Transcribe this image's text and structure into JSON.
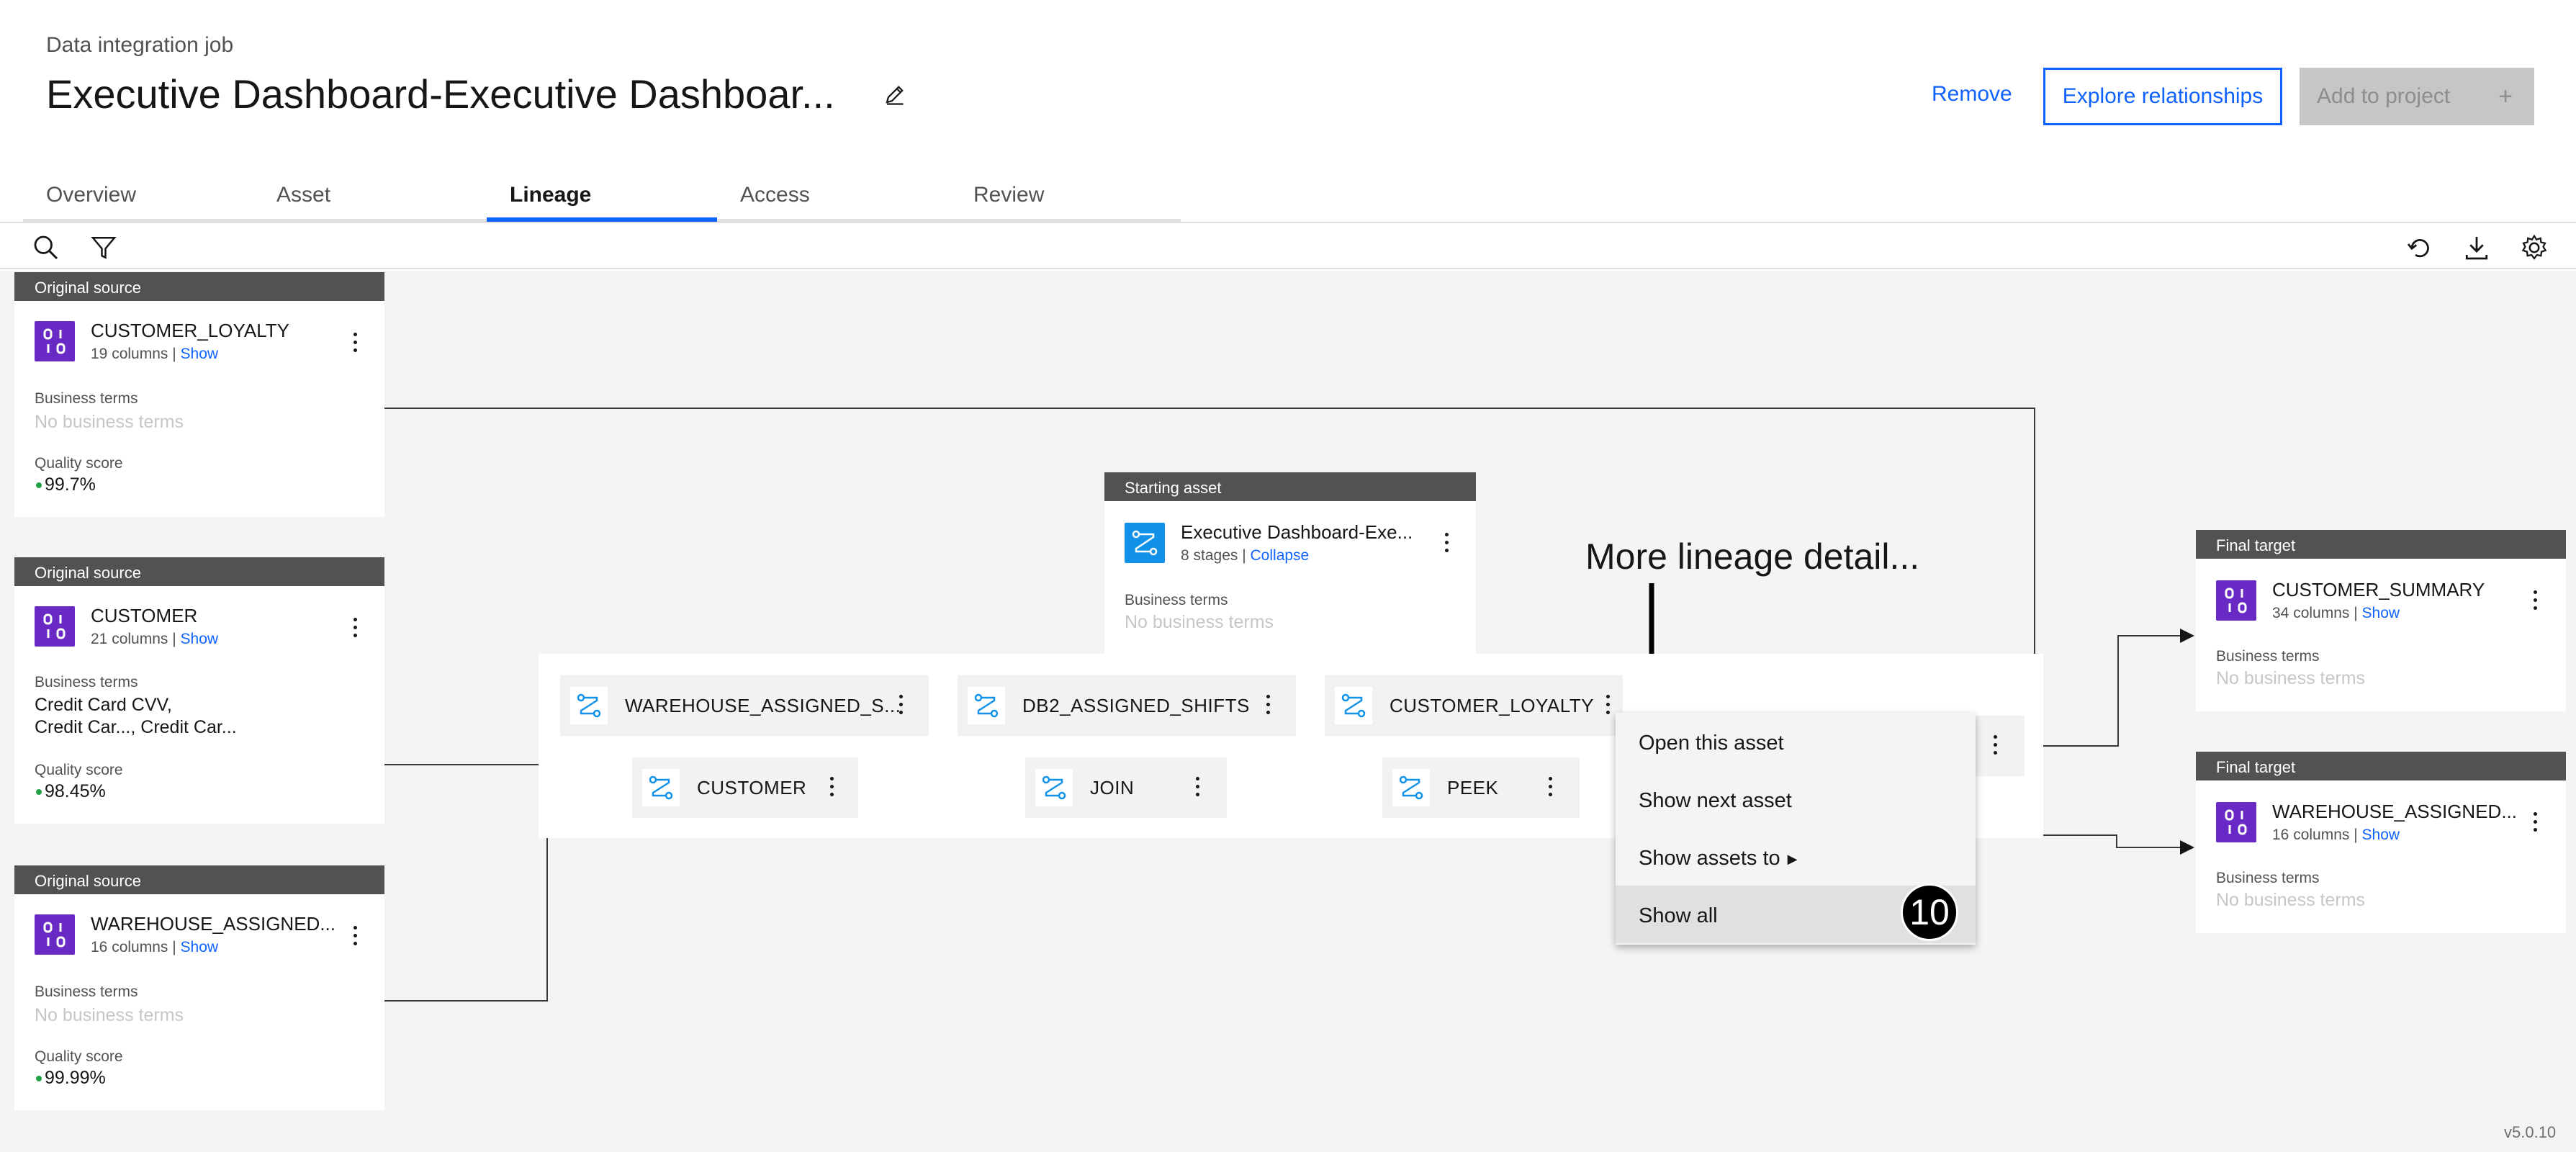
{
  "header": {
    "breadcrumb": "Data integration job",
    "title": "Executive Dashboard-Executive Dashboar...",
    "remove_label": "Remove",
    "explore_label": "Explore relationships",
    "add_label": "Add to project",
    "add_plus": "+"
  },
  "tabs": [
    {
      "label": "Overview",
      "active": false
    },
    {
      "label": "Asset",
      "active": false
    },
    {
      "label": "Lineage",
      "active": true
    },
    {
      "label": "Access",
      "active": false
    },
    {
      "label": "Review",
      "active": false
    }
  ],
  "toolbar": {
    "left_icons": [
      "search-icon",
      "filter-icon"
    ],
    "right_icons": [
      "reset-icon",
      "download-icon",
      "settings-icon"
    ]
  },
  "sources": [
    {
      "header": "Original source",
      "name": "CUSTOMER_LOYALTY",
      "sub": "19 columns | ",
      "link": "Show",
      "terms_label": "Business terms",
      "terms": "No business terms",
      "quality_label": "Quality score",
      "quality": "99.7%"
    },
    {
      "header": "Original source",
      "name": "CUSTOMER",
      "sub": "21 columns | ",
      "link": "Show",
      "terms_label": "Business terms",
      "terms_line1": "Credit Card CVV,",
      "terms_line2": "Credit Car..., Credit Car...",
      "quality_label": "Quality score",
      "quality": "98.45%"
    },
    {
      "header": "Original source",
      "name": "WAREHOUSE_ASSIGNED...",
      "sub": "16 columns | ",
      "link": "Show",
      "terms_label": "Business terms",
      "terms": "No business terms",
      "quality_label": "Quality score",
      "quality": "99.99%"
    }
  ],
  "starting": {
    "header": "Starting asset",
    "name": "Executive Dashboard-Exe...",
    "sub": "8 stages | ",
    "link": "Collapse",
    "terms_label": "Business terms",
    "terms": "No business terms"
  },
  "stages": [
    "WAREHOUSE_ASSIGNED_S...",
    "DB2_ASSIGNED_SHIFTS",
    "CUSTOMER_LOYALTY",
    "CUSTOMER",
    "JOIN",
    "PEEK"
  ],
  "targets": [
    {
      "header": "Final target",
      "name": "CUSTOMER_SUMMARY",
      "sub": "34 columns | ",
      "link": "Show",
      "terms_label": "Business terms",
      "terms": "No business terms"
    },
    {
      "header": "Final target",
      "name": "WAREHOUSE_ASSIGNED...",
      "sub": "16 columns | ",
      "link": "Show",
      "terms_label": "Business terms",
      "terms": "No business terms"
    }
  ],
  "context_menu": {
    "items": [
      "Open this asset",
      "Show next asset",
      "Show assets to",
      "Show all"
    ],
    "selected": "Show all"
  },
  "annotation": {
    "text": "More lineage detail...",
    "step": "10"
  },
  "version": "v5.0.10",
  "colors": {
    "accent": "#0f62fe",
    "asset_purple": "#6929c4",
    "stage_blue": "#1192e8",
    "quality_green": "#24a148",
    "card_header": "#525252"
  }
}
